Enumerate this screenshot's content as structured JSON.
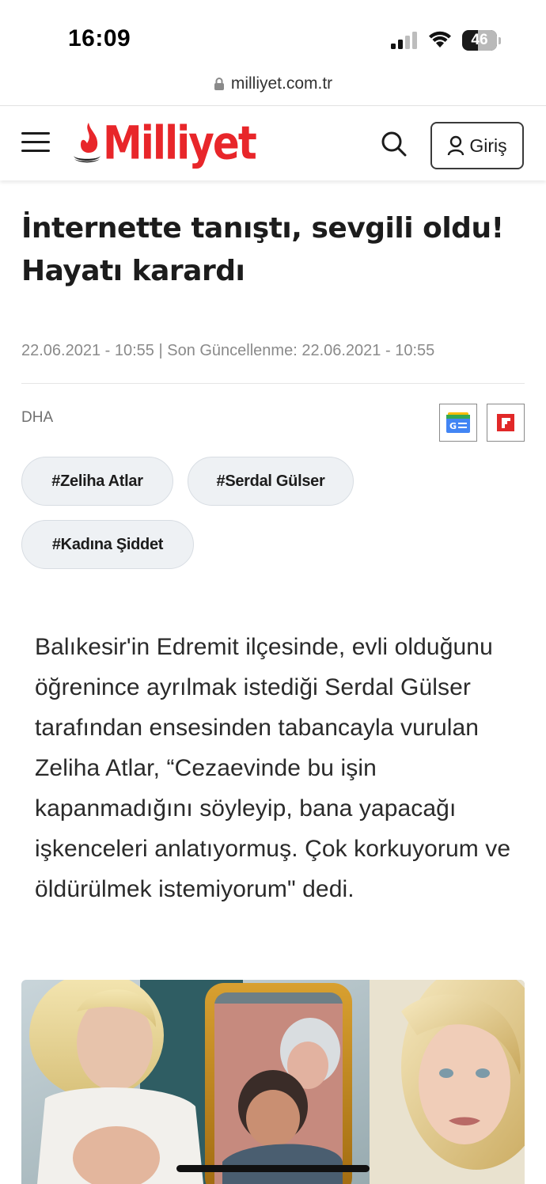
{
  "status_bar": {
    "time": "16:09",
    "battery_level": "46"
  },
  "browser": {
    "url": "milliyet.com.tr"
  },
  "header": {
    "logo_text": "Milliyet",
    "login_label": "Giriş",
    "brand_color": "#e8262a"
  },
  "article": {
    "headline": "İnternette tanıştı, sevgili oldu! Hayatı karardı",
    "meta": "22.06.2021 - 10:55 | Son Güncellenme: 22.06.2021 - 10:55",
    "source": "DHA",
    "tags": [
      "#Zeliha Atlar",
      "#Serdal Gülser",
      "#Kadına Şiddet"
    ],
    "summary": "Balıkesir'in Edremit ilçesinde, evli olduğunu öğrenince ayrılmak istediği Serdal Gülser tarafından ensesinden tabancayla vurulan Zeliha Atlar, “Cezaevinde bu işin kapanmadığını söyleyip, bana yapacağı işkenceleri anlatıyormuş. Çok korkuyorum ve öldürülmek istemiyorum\" dedi.",
    "share": [
      "google-news-icon",
      "flipboard-icon"
    ]
  }
}
